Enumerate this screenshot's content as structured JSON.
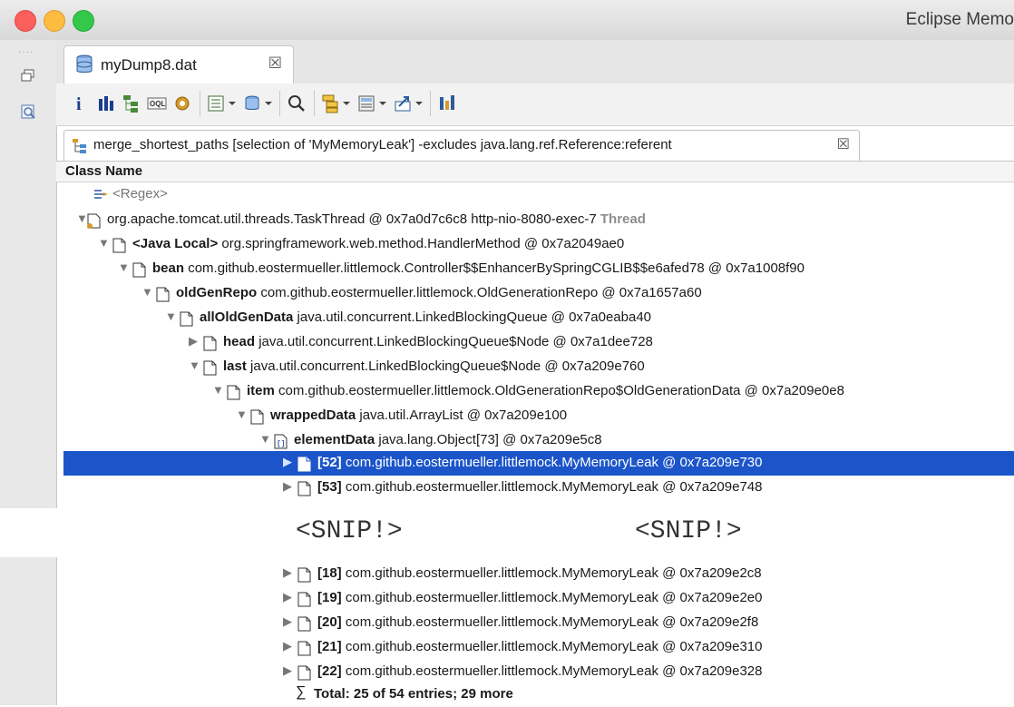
{
  "window": {
    "title": "Eclipse Memo"
  },
  "editor_tab": {
    "label": "myDump8.dat",
    "close": "☒"
  },
  "panel_tab": {
    "label": "merge_shortest_paths [selection of 'MyMemoryLeak'] -excludes java.lang.ref.Reference:referent",
    "close": "☒"
  },
  "column_header": "Class Name",
  "tree": {
    "regex": "<Regex>",
    "rows": [
      {
        "arrow": "▼",
        "name": "",
        "cls": "org.apache.tomcat.util.threads.TaskThread @ 0x7a0d7c6c8  http-nio-8080-exec-7",
        "tag": "Thread"
      },
      {
        "arrow": "▼",
        "name": "<Java Local>",
        "cls": "org.springframework.web.method.HandlerMethod @ 0x7a2049ae0"
      },
      {
        "arrow": "▼",
        "name": "bean",
        "cls": "com.github.eostermueller.littlemock.Controller$$EnhancerBySpringCGLIB$$e6afed78 @ 0x7a1008f90"
      },
      {
        "arrow": "▼",
        "name": "oldGenRepo",
        "cls": "com.github.eostermueller.littlemock.OldGenerationRepo @ 0x7a1657a60"
      },
      {
        "arrow": "▼",
        "name": "allOldGenData",
        "cls": "java.util.concurrent.LinkedBlockingQueue @ 0x7a0eaba40"
      },
      {
        "arrow": "▶",
        "name": "head",
        "cls": "java.util.concurrent.LinkedBlockingQueue$Node @ 0x7a1dee728"
      },
      {
        "arrow": "▼",
        "name": "last",
        "cls": "java.util.concurrent.LinkedBlockingQueue$Node @ 0x7a209e760"
      },
      {
        "arrow": "▼",
        "name": "item",
        "cls": "com.github.eostermueller.littlemock.OldGenerationRepo$OldGenerationData @ 0x7a209e0e8"
      },
      {
        "arrow": "▼",
        "name": "wrappedData",
        "cls": "java.util.ArrayList @ 0x7a209e100"
      },
      {
        "arrow": "▼",
        "name": "elementData",
        "cls": "java.lang.Object[73] @ 0x7a209e5c8"
      },
      {
        "arrow": "▶",
        "name": "[52]",
        "cls": "com.github.eostermueller.littlemock.MyMemoryLeak @ 0x7a209e730"
      },
      {
        "arrow": "▶",
        "name": "[53]",
        "cls": "com.github.eostermueller.littlemock.MyMemoryLeak @ 0x7a209e748"
      }
    ],
    "lower_rows": [
      {
        "arrow": "▶",
        "name": "[18]",
        "cls": "com.github.eostermueller.littlemock.MyMemoryLeak @ 0x7a209e2c8"
      },
      {
        "arrow": "▶",
        "name": "[19]",
        "cls": "com.github.eostermueller.littlemock.MyMemoryLeak @ 0x7a209e2e0"
      },
      {
        "arrow": "▶",
        "name": "[20]",
        "cls": "com.github.eostermueller.littlemock.MyMemoryLeak @ 0x7a209e2f8"
      },
      {
        "arrow": "▶",
        "name": "[21]",
        "cls": "com.github.eostermueller.littlemock.MyMemoryLeak @ 0x7a209e310"
      },
      {
        "arrow": "▶",
        "name": "[22]",
        "cls": "com.github.eostermueller.littlemock.MyMemoryLeak @ 0x7a209e328"
      }
    ],
    "total": "Total: 25 of 54 entries; 29 more"
  },
  "snip": {
    "left": "<SNIP!>",
    "right": "<SNIP!>"
  },
  "colors": {
    "selection": "#1c55c9",
    "thread_tag": "#8d8d8d"
  }
}
